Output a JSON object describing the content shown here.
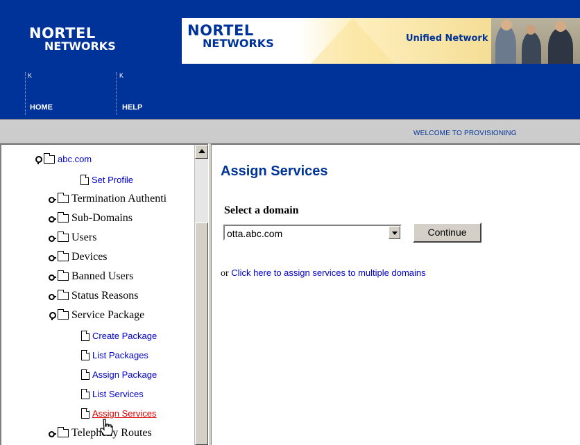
{
  "header": {
    "logo_line1": "NORTEL",
    "logo_line2": "NETWORKS",
    "banner_logo_line1": "NORTEL",
    "banner_logo_line2": "NETWORKS",
    "banner_tagline": "Unified Network",
    "nav": [
      {
        "label": "HOME",
        "marker": "K"
      },
      {
        "label": "HELP",
        "marker": "K"
      }
    ]
  },
  "welcome_text": "WELCOME TO PROVISIONING",
  "tree": {
    "root": {
      "label": "abc.com",
      "state": "expanded"
    },
    "items": [
      {
        "label": "Set Profile",
        "type": "doc"
      },
      {
        "label": "Termination Authenti",
        "type": "folder",
        "state": "collapsed"
      },
      {
        "label": "Sub-Domains",
        "type": "folder",
        "state": "collapsed"
      },
      {
        "label": "Users",
        "type": "folder",
        "state": "collapsed"
      },
      {
        "label": "Devices",
        "type": "folder",
        "state": "collapsed"
      },
      {
        "label": "Banned Users",
        "type": "folder",
        "state": "collapsed"
      },
      {
        "label": "Status Reasons",
        "type": "folder",
        "state": "collapsed"
      },
      {
        "label": "Service Package",
        "type": "folder",
        "state": "expanded"
      },
      {
        "label": "Create Package",
        "type": "doc"
      },
      {
        "label": "List Packages",
        "type": "doc"
      },
      {
        "label": "Assign Package",
        "type": "doc"
      },
      {
        "label": "List Services",
        "type": "doc"
      },
      {
        "label": "Assign Services",
        "type": "doc",
        "active": true
      },
      {
        "label": "Telephony Routes",
        "type": "folder",
        "state": "collapsed"
      }
    ]
  },
  "main": {
    "title": "Assign Services",
    "domain_label": "Select a domain",
    "domain_value": "otta.abc.com",
    "continue_label": "Continue",
    "or_text": "or",
    "multi_link": "Click here to assign services to multiple domains"
  },
  "colors": {
    "header_bg": "#003399",
    "link": "#0000cc",
    "active_link": "#dd0000",
    "title": "#003399"
  }
}
